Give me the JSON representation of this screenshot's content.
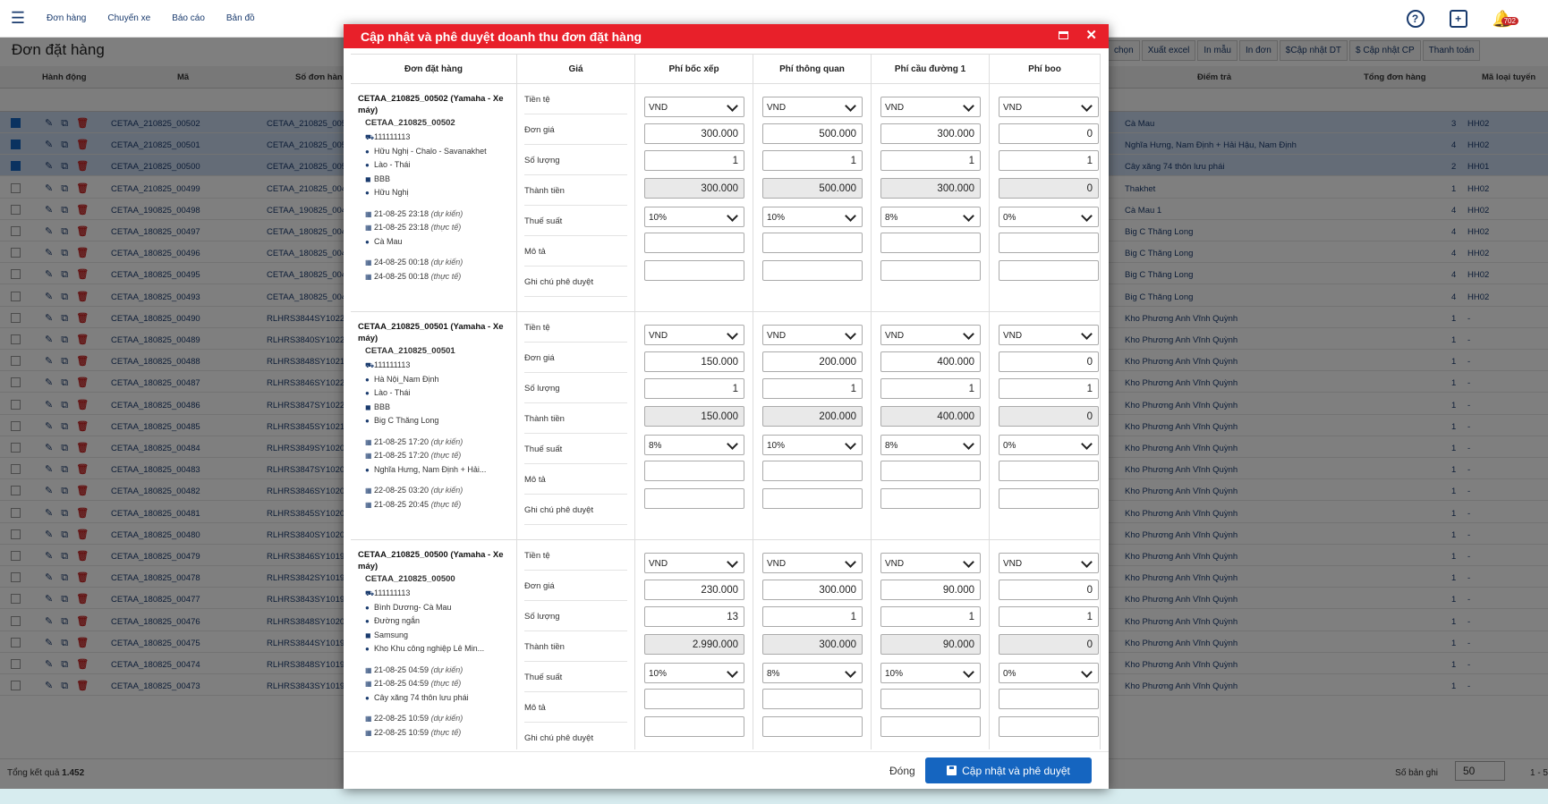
{
  "topnav": [
    "Đơn hàng",
    "Chuyến xe",
    "Báo cáo",
    "Bản đồ"
  ],
  "notif_count": "702",
  "page_title": "Đơn đặt hàng",
  "actions": [
    "chọn",
    "Xuất excel",
    "In mẫu",
    "In đơn",
    "$Cập nhật DT",
    "$ Cập nhật CP",
    "Thanh toán"
  ],
  "columns": {
    "action": "Hành động",
    "code": "Mã",
    "order_no": "Số đơn hàn",
    "dest": "Điểm trả",
    "total": "Tổng đơn hàng",
    "type": "Mã loại tuyến"
  },
  "rows": [
    {
      "code": "CETAA_210825_00502",
      "order": "CETAA_210825_005",
      "dest": "Cà Mau",
      "total": "3",
      "type": "HH02",
      "selected": true
    },
    {
      "code": "CETAA_210825_00501",
      "order": "CETAA_210825_005",
      "dest": "Nghĩa Hưng, Nam Định + Hải Hậu, Nam Định",
      "total": "4",
      "type": "HH02",
      "selected": true
    },
    {
      "code": "CETAA_210825_00500",
      "order": "CETAA_210825_005",
      "dest": "Cây xăng 74 thôn lưu phái",
      "total": "2",
      "type": "HH01",
      "selected": true
    },
    {
      "code": "CETAA_210825_00499",
      "order": "CETAA_210825_004",
      "dest": "Thakhet",
      "total": "1",
      "type": "HH02",
      "selected": false
    },
    {
      "code": "CETAA_190825_00498",
      "order": "CETAA_190825_004",
      "dest": "Cà Mau 1",
      "total": "4",
      "type": "HH02",
      "selected": false
    },
    {
      "code": "CETAA_180825_00497",
      "order": "CETAA_180825_004",
      "dest": "Big C Thăng Long",
      "total": "4",
      "type": "HH02",
      "selected": false
    },
    {
      "code": "CETAA_180825_00496",
      "order": "CETAA_180825_004",
      "dest": "Big C Thăng Long",
      "total": "4",
      "type": "HH02",
      "selected": false
    },
    {
      "code": "CETAA_180825_00495",
      "order": "CETAA_180825_004",
      "dest": "Big C Thăng Long",
      "total": "4",
      "type": "HH02",
      "selected": false
    },
    {
      "code": "CETAA_180825_00493",
      "order": "CETAA_180825_004",
      "dest": "Big C Thăng Long",
      "total": "4",
      "type": "HH02",
      "selected": false
    },
    {
      "code": "CETAA_180825_00490",
      "order": "RLHRS3844SY10220",
      "dest": "Kho Phương Anh Vĩnh Quỳnh",
      "total": "1",
      "type": "-",
      "selected": false
    },
    {
      "code": "CETAA_180825_00489",
      "order": "RLHRS3840SY10220",
      "dest": "Kho Phương Anh Vĩnh Quỳnh",
      "total": "1",
      "type": "-",
      "selected": false
    },
    {
      "code": "CETAA_180825_00488",
      "order": "RLHRS3848SY10211",
      "dest": "Kho Phương Anh Vĩnh Quỳnh",
      "total": "1",
      "type": "-",
      "selected": false
    },
    {
      "code": "CETAA_180825_00487",
      "order": "RLHRS3846SY10221",
      "dest": "Kho Phương Anh Vĩnh Quỳnh",
      "total": "1",
      "type": "-",
      "selected": false
    },
    {
      "code": "CETAA_180825_00486",
      "order": "RLHRS3847SY10220",
      "dest": "Kho Phương Anh Vĩnh Quỳnh",
      "total": "1",
      "type": "-",
      "selected": false
    },
    {
      "code": "CETAA_180825_00485",
      "order": "RLHRS3845SY10210",
      "dest": "Kho Phương Anh Vĩnh Quỳnh",
      "total": "1",
      "type": "-",
      "selected": false
    },
    {
      "code": "CETAA_180825_00484",
      "order": "RLHRS3849SY10201",
      "dest": "Kho Phương Anh Vĩnh Quỳnh",
      "total": "1",
      "type": "-",
      "selected": false
    },
    {
      "code": "CETAA_180825_00483",
      "order": "RLHRS3847SY10200",
      "dest": "Kho Phương Anh Vĩnh Quỳnh",
      "total": "1",
      "type": "-",
      "selected": false
    },
    {
      "code": "CETAA_180825_00482",
      "order": "RLHRS3846SY10201",
      "dest": "Kho Phương Anh Vĩnh Quỳnh",
      "total": "1",
      "type": "-",
      "selected": false
    },
    {
      "code": "CETAA_180825_00481",
      "order": "RLHRS3845SY10200",
      "dest": "Kho Phương Anh Vĩnh Quỳnh",
      "total": "1",
      "type": "-",
      "selected": false
    },
    {
      "code": "CETAA_180825_00480",
      "order": "RLHRS3840SY10201",
      "dest": "Kho Phương Anh Vĩnh Quỳnh",
      "total": "1",
      "type": "-",
      "selected": false
    },
    {
      "code": "CETAA_180825_00479",
      "order": "RLHRS3846SY10199",
      "dest": "Kho Phương Anh Vĩnh Quỳnh",
      "total": "1",
      "type": "-",
      "selected": false
    },
    {
      "code": "CETAA_180825_00478",
      "order": "RLHRS3842SY10199",
      "dest": "Kho Phương Anh Vĩnh Quỳnh",
      "total": "1",
      "type": "-",
      "selected": false
    },
    {
      "code": "CETAA_180825_00477",
      "order": "RLHRS3843SY10199",
      "dest": "Kho Phương Anh Vĩnh Quỳnh",
      "total": "1",
      "type": "-",
      "selected": false
    },
    {
      "code": "CETAA_180825_00476",
      "order": "RLHRS3848SY10201",
      "dest": "Kho Phương Anh Vĩnh Quỳnh",
      "total": "1",
      "type": "-",
      "selected": false
    },
    {
      "code": "CETAA_180825_00475",
      "order": "RLHRS3844SY10199",
      "dest": "Kho Phương Anh Vĩnh Quỳnh",
      "total": "1",
      "type": "-",
      "selected": false
    },
    {
      "code": "CETAA_180825_00474",
      "order": "RLHRS3848SY10199",
      "dest": "Kho Phương Anh Vĩnh Quỳnh",
      "total": "1",
      "type": "-",
      "selected": false
    },
    {
      "code": "CETAA_180825_00473",
      "order": "RLHRS3843SY10199",
      "dest": "Kho Phương Anh Vĩnh Quỳnh",
      "total": "1",
      "type": "-",
      "selected": false
    }
  ],
  "footer": {
    "total_label": "Tổng kết quả",
    "total_value": "1.452",
    "per_page_label": "Số bản ghi",
    "per_page": "50",
    "range": "1 - 5"
  },
  "modal": {
    "title": "Cập nhật và phê duyệt doanh thu đơn đặt hàng",
    "headers": [
      "Đơn đặt hàng",
      "Giá",
      "Phí bốc xếp",
      "Phí thông quan",
      "Phí cầu đường 1",
      "Phí boo"
    ],
    "row_labels": [
      "Tiền tệ",
      "Đơn giá",
      "Số lượng",
      "Thành tiền",
      "Thuế suất",
      "Mô tả",
      "Ghi chú phê duyệt"
    ],
    "close_label": "Đóng",
    "save_label": "Cập nhật và phê duyệt",
    "orders": [
      {
        "title": "CETAA_210825_00502 (Yamaha - Xe máy)",
        "code": "CETAA_210825_00502",
        "info": [
          "111111113",
          "Hữu Nghị - Chalo - Savanakhet",
          "Lào - Thái",
          "BBB",
          "Hữu Nghị"
        ],
        "times": [
          "21-08-25 23:18",
          "21-08-25 23:18"
        ],
        "place1": "Cà Mau",
        "times2": [
          "24-08-25 00:18",
          "24-08-25 00:18"
        ],
        "fees": [
          {
            "cur": "VND",
            "price": "300.000",
            "qty": "1",
            "total": "300.000",
            "tax": "10%"
          },
          {
            "cur": "VND",
            "price": "500.000",
            "qty": "1",
            "total": "500.000",
            "tax": "10%"
          },
          {
            "cur": "VND",
            "price": "300.000",
            "qty": "1",
            "total": "300.000",
            "tax": "8%"
          },
          {
            "cur": "VND",
            "price": "0",
            "qty": "1",
            "total": "0",
            "tax": "0%"
          }
        ]
      },
      {
        "title": "CETAA_210825_00501 (Yamaha - Xe máy)",
        "code": "CETAA_210825_00501",
        "info": [
          "111111113",
          "Hà Nội_Nam Định",
          "Lào - Thái",
          "BBB",
          "Big C Thăng Long"
        ],
        "times": [
          "21-08-25 17:20",
          "21-08-25 17:20"
        ],
        "place1": "Nghĩa Hưng, Nam Định + Hải...",
        "times2": [
          "22-08-25 03:20",
          "21-08-25 20:45"
        ],
        "fees": [
          {
            "cur": "VND",
            "price": "150.000",
            "qty": "1",
            "total": "150.000",
            "tax": "8%"
          },
          {
            "cur": "VND",
            "price": "200.000",
            "qty": "1",
            "total": "200.000",
            "tax": "10%"
          },
          {
            "cur": "VND",
            "price": "400.000",
            "qty": "1",
            "total": "400.000",
            "tax": "8%"
          },
          {
            "cur": "VND",
            "price": "0",
            "qty": "1",
            "total": "0",
            "tax": "0%"
          }
        ]
      },
      {
        "title": "CETAA_210825_00500 (Yamaha - Xe máy)",
        "code": "CETAA_210825_00500",
        "info": [
          "111111113",
          "Bình Dương- Cà Mau",
          "Đường ngắn",
          "Samsung",
          "Kho Khu công nghiệp Lê Min..."
        ],
        "times": [
          "21-08-25 04:59",
          "21-08-25 04:59"
        ],
        "place1": "Cây xăng 74 thôn lưu phái",
        "times2": [
          "22-08-25 10:59",
          "22-08-25 10:59"
        ],
        "fees": [
          {
            "cur": "VND",
            "price": "230.000",
            "qty": "13",
            "total": "2.990.000",
            "tax": "10%"
          },
          {
            "cur": "VND",
            "price": "300.000",
            "qty": "1",
            "total": "300.000",
            "tax": "8%"
          },
          {
            "cur": "VND",
            "price": "90.000",
            "qty": "1",
            "total": "90.000",
            "tax": "10%"
          },
          {
            "cur": "VND",
            "price": "0",
            "qty": "1",
            "total": "0",
            "tax": "0%"
          }
        ]
      }
    ],
    "expected_label": "(dự kiến)",
    "actual_label": "(thực tế)"
  }
}
